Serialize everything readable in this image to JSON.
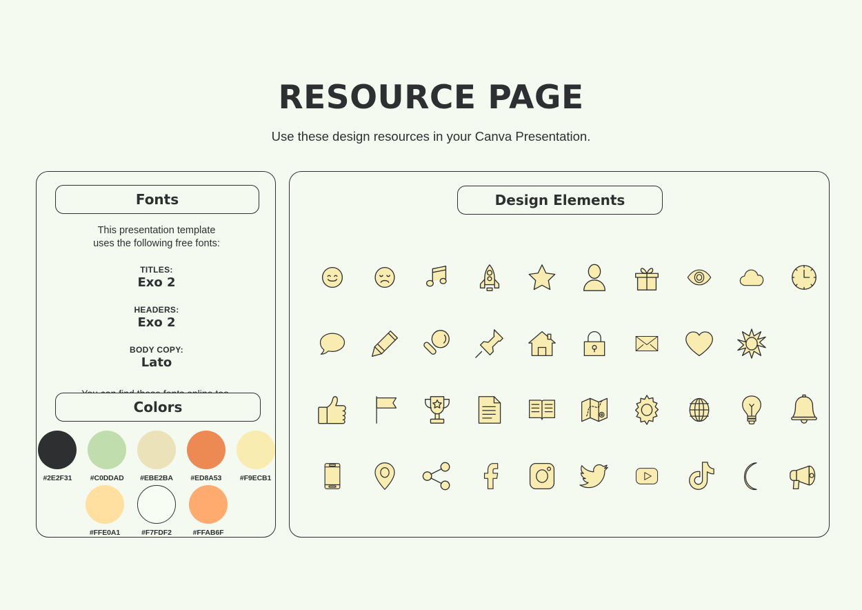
{
  "header": {
    "title": "RESOURCE PAGE",
    "subtitle": "Use these design resources in your Canva Presentation."
  },
  "fonts_panel": {
    "heading": "Fonts",
    "intro_line_1": "This presentation template",
    "intro_line_2": "uses the following free fonts:",
    "groups": [
      {
        "label": "TITLES:",
        "name": "Exo 2"
      },
      {
        "label": "HEADERS:",
        "name": "Exo 2"
      },
      {
        "label": "BODY COPY:",
        "name": "Lato"
      }
    ],
    "outro": "You can find these fonts online too."
  },
  "colors_panel": {
    "heading": "Colors",
    "row_1": [
      {
        "hex": "#2E2F31",
        "outlined": false
      },
      {
        "hex": "#C0DDAD",
        "outlined": false
      },
      {
        "hex": "#EBE2BA",
        "outlined": false
      },
      {
        "hex": "#ED8A53",
        "outlined": false
      },
      {
        "hex": "#F9ECB1",
        "outlined": false
      }
    ],
    "row_2": [
      {
        "hex": "#FFE0A1",
        "outlined": false
      },
      {
        "hex": "#F7FDF2",
        "outlined": true
      },
      {
        "hex": "#FFAB6F",
        "outlined": false
      }
    ]
  },
  "elements_panel": {
    "heading": "Design Elements",
    "icon_rows": [
      [
        "smile-face-icon",
        "sad-face-icon",
        "music-note-icon",
        "rocket-icon",
        "star-icon",
        "person-icon",
        "gift-icon",
        "eye-icon",
        "cloud-icon",
        "clock-icon"
      ],
      [
        "speech-bubble-icon",
        "pencil-icon",
        "magnifier-icon",
        "pushpin-icon",
        "house-icon",
        "lock-icon",
        "envelope-icon",
        "heart-icon",
        "sun-icon"
      ],
      [
        "thumbs-up-icon",
        "flag-icon",
        "trophy-icon",
        "document-icon",
        "book-icon",
        "map-icon",
        "gear-icon",
        "globe-icon",
        "lightbulb-icon",
        "bell-icon"
      ],
      [
        "phone-icon",
        "location-pin-icon",
        "share-icon",
        "facebook-icon",
        "instagram-icon",
        "twitter-icon",
        "youtube-icon",
        "tiktok-icon",
        "moon-icon",
        "megaphone-icon"
      ]
    ]
  },
  "theme": {
    "background": "#F4FAF0",
    "ink": "#2E2F31",
    "icon_fill": "#F9ECB1"
  }
}
